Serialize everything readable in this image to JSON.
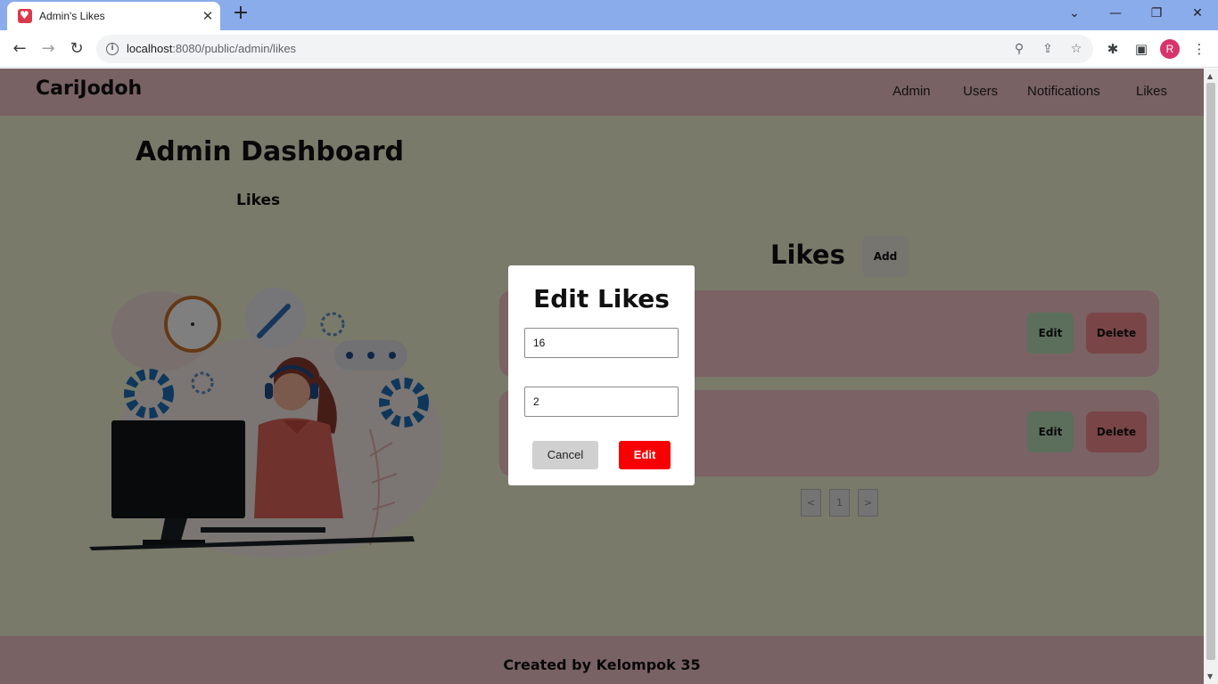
{
  "browser": {
    "tab_title": "Admin's Likes",
    "tab_close_glyph": "✕",
    "new_tab_glyph": "+",
    "url_host": "localhost",
    "url_path": ":8080/public/admin/likes",
    "profile_initial": "R",
    "icons": {
      "favicon": "heart-icon",
      "back": "arrow-left-icon",
      "forward": "arrow-right-icon",
      "reload": "reload-icon",
      "info": "info-icon",
      "zoom": "zoom-icon",
      "share": "share-icon",
      "bookmark": "star-icon",
      "extensions": "puzzle-icon",
      "sidepanel": "side-panel-icon",
      "menu": "kebab-menu-icon"
    }
  },
  "site": {
    "logo": "CariJodoh",
    "nav": [
      "Admin",
      "Users",
      "Notifications",
      "Likes"
    ]
  },
  "dashboard": {
    "title": "Admin Dashboard",
    "subtitle": "Likes"
  },
  "likes_panel": {
    "heading": "Likes",
    "add_label": "Add",
    "rows": [
      {
        "edit_label": "Edit",
        "delete_label": "Delete"
      },
      {
        "edit_label": "Edit",
        "delete_label": "Delete"
      }
    ],
    "pagination": [
      "<",
      "1",
      ">"
    ]
  },
  "modal": {
    "title": "Edit Likes",
    "field1_value": "16",
    "field2_value": "2",
    "cancel_label": "Cancel",
    "submit_label": "Edit"
  },
  "footer": {
    "text": "Created by Kelompok 35"
  },
  "colors": {
    "nav_pink": "#f3c5c9",
    "page_bg": "#f5f4d7",
    "card_pink": "#f6c4c9",
    "edit_green": "#b7dfb9",
    "delete_red": "#f48a8f",
    "modal_submit_red": "#f80000"
  }
}
